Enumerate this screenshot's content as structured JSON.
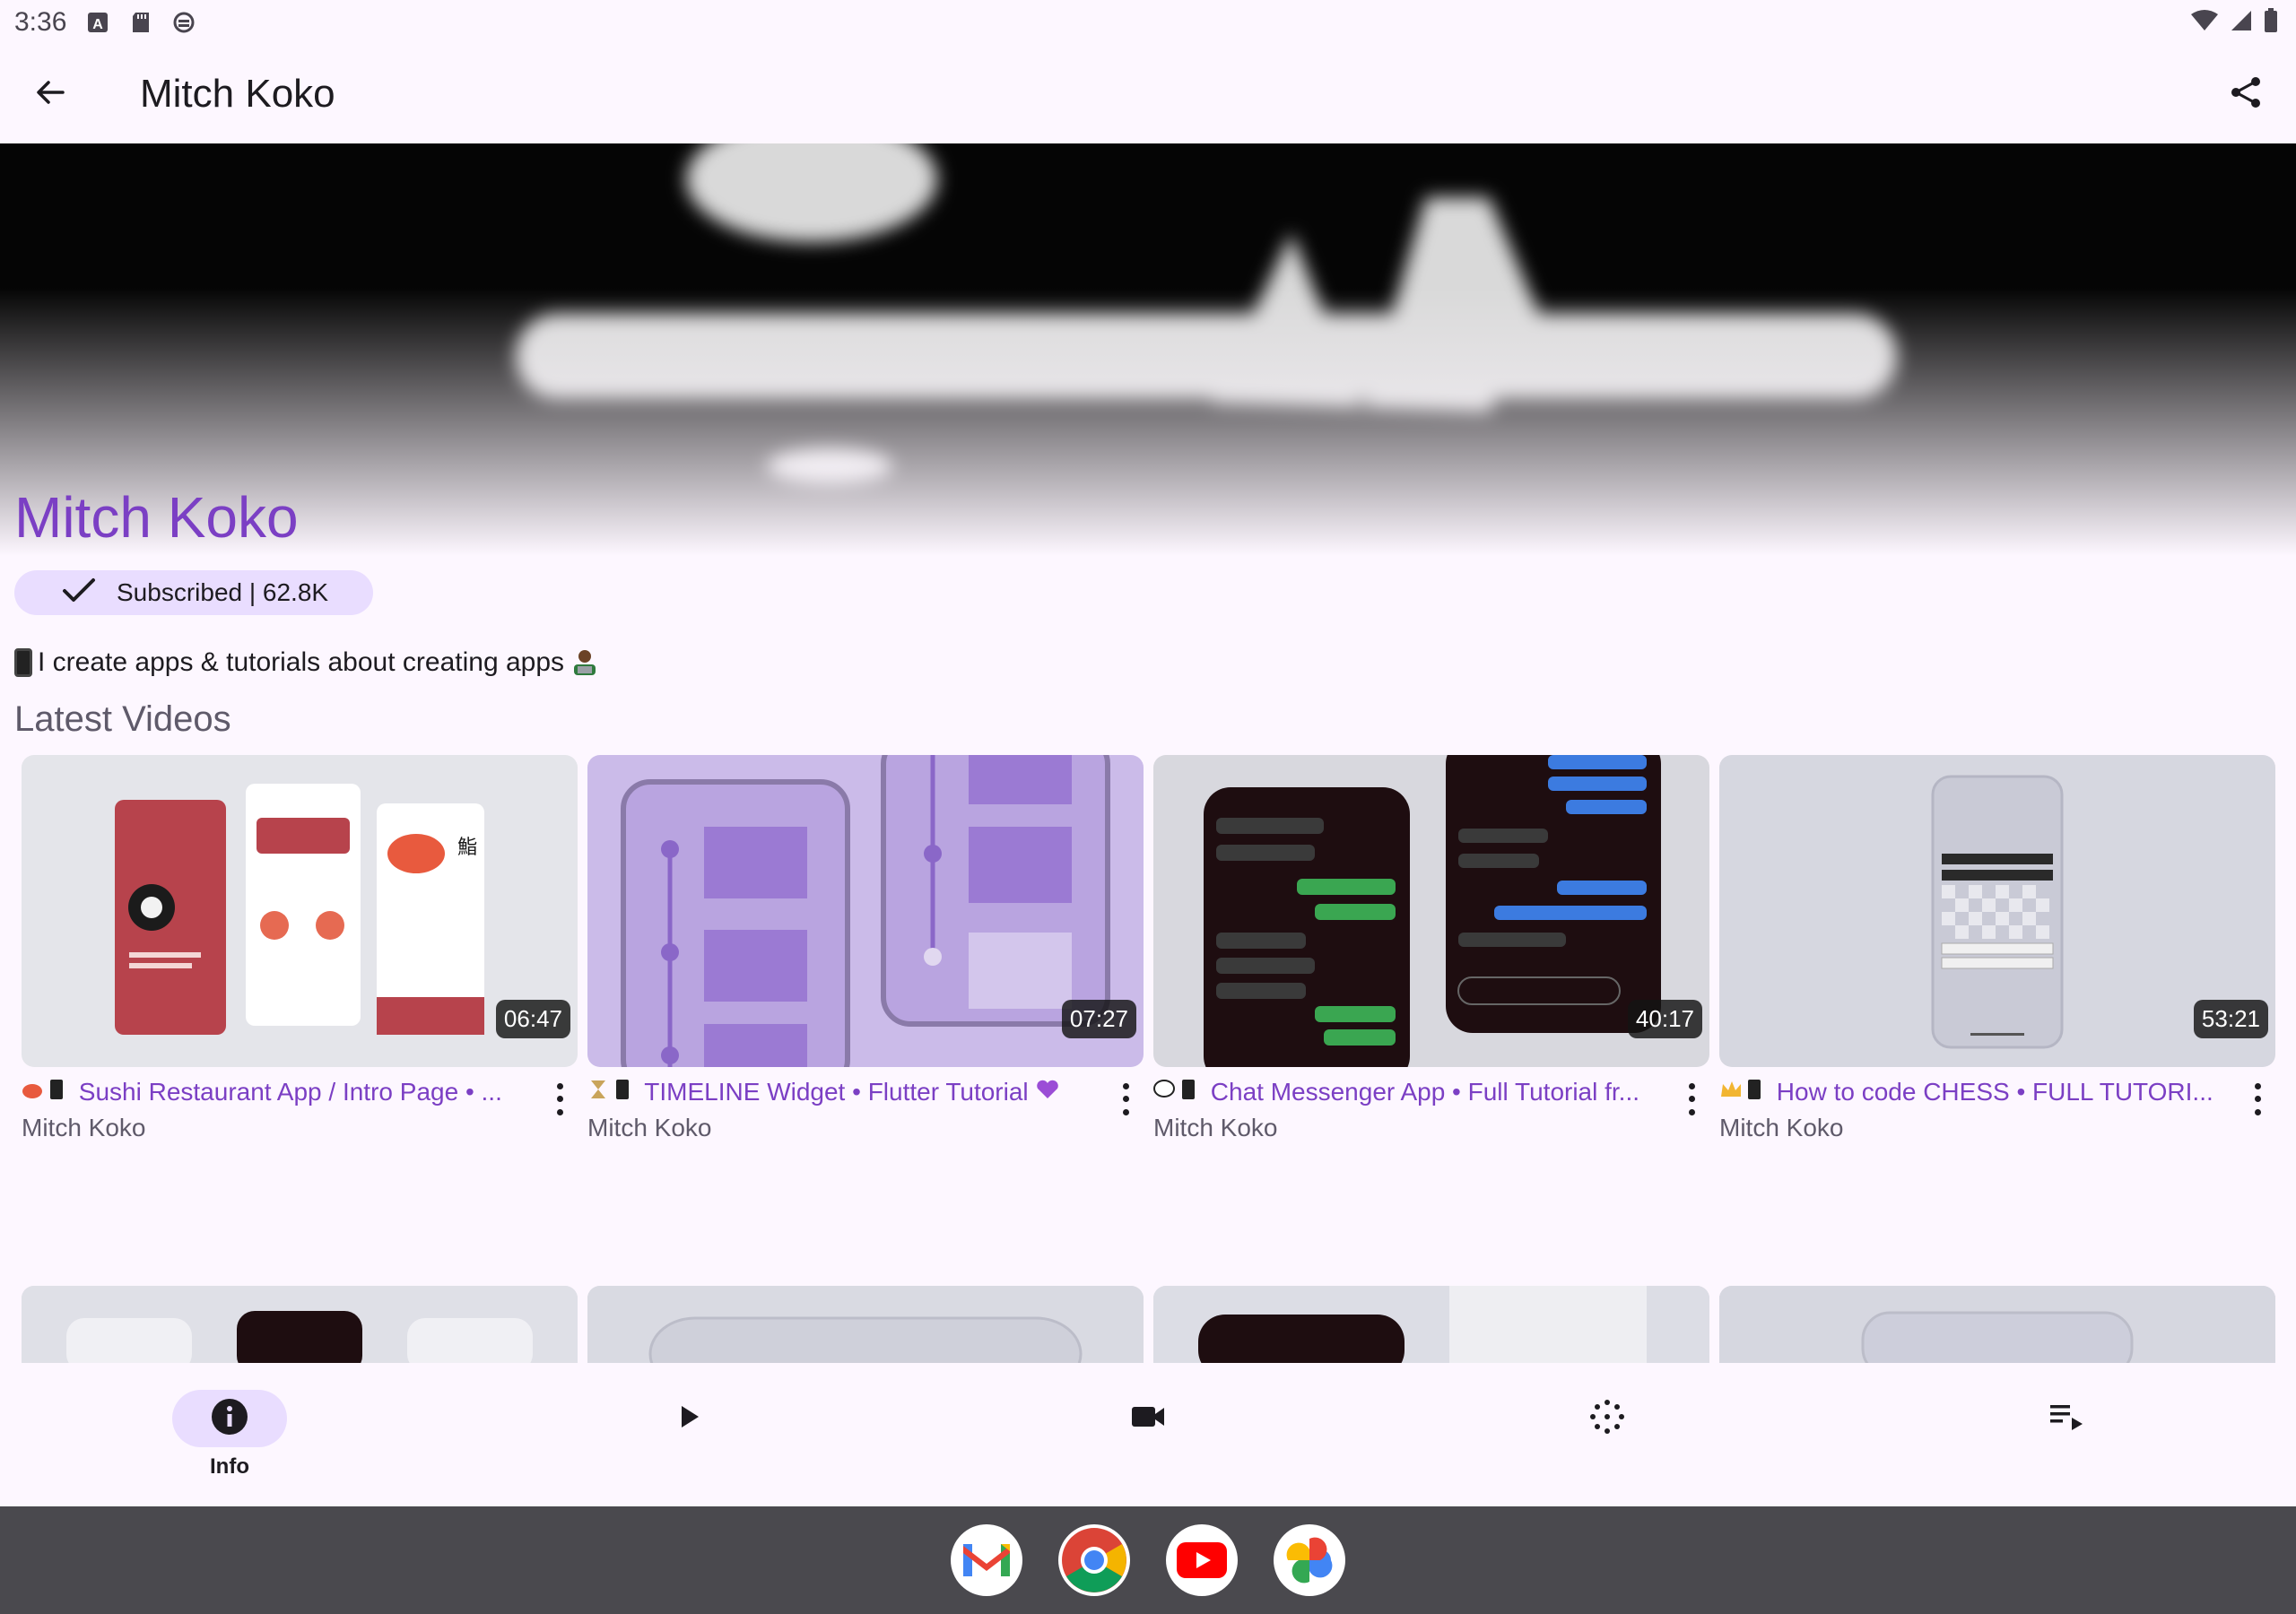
{
  "status_bar": {
    "time": "3:36",
    "icons_left": [
      "a-badge-icon",
      "sd-card-icon",
      "app-icon"
    ],
    "icons_right": [
      "wifi-icon",
      "signal-icon",
      "battery-icon"
    ]
  },
  "app_bar": {
    "title": "Mitch Koko",
    "back_icon": "arrow-back-icon",
    "share_icon": "share-icon"
  },
  "channel": {
    "name": "Mitch Koko",
    "subscribe_label": "Subscribed | 62.8K",
    "description": "I create apps & tutorials about creating apps"
  },
  "section_title": "Latest Videos",
  "videos": [
    {
      "title": "Sushi Restaurant App / Intro Page • ...",
      "prefix_emoji": "sushi-phone",
      "channel": "Mitch Koko",
      "duration": "06:47"
    },
    {
      "title": "TIMELINE Widget • Flutter Tutorial",
      "prefix_emoji": "hourglass-phone",
      "channel": "Mitch Koko",
      "duration": "07:27"
    },
    {
      "title": "Chat Messenger App • Full Tutorial fr...",
      "prefix_emoji": "speech-phone",
      "channel": "Mitch Koko",
      "duration": "40:17"
    },
    {
      "title": "How to code CHESS • FULL TUTORI...",
      "prefix_emoji": "crown-phone",
      "channel": "Mitch Koko",
      "duration": "53:21"
    }
  ],
  "bottom_nav": {
    "items": [
      {
        "label": "Info",
        "icon": "info-icon",
        "active": true
      },
      {
        "label": "",
        "icon": "play-icon",
        "active": false
      },
      {
        "label": "",
        "icon": "video-camera-icon",
        "active": false
      },
      {
        "label": "",
        "icon": "shorts-spinner-icon",
        "active": false
      },
      {
        "label": "",
        "icon": "playlist-icon",
        "active": false
      }
    ]
  },
  "taskbar": {
    "apps": [
      "gmail-icon",
      "chrome-icon",
      "youtube-icon",
      "photos-icon"
    ]
  },
  "colors": {
    "accent": "#7b3fc4",
    "chip": "#e9ddff",
    "background": "#fdf7ff",
    "taskbar": "#4a494e"
  }
}
